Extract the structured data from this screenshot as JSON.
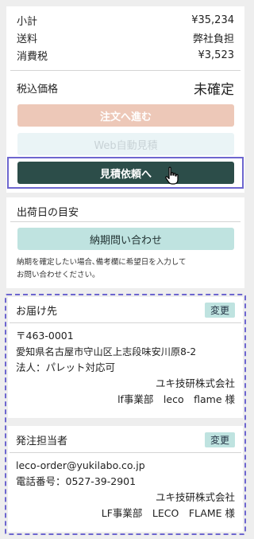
{
  "summary": {
    "subtotal_label": "小計",
    "subtotal_value": "¥35,234",
    "shipping_label": "送料",
    "shipping_value": "弊社負担",
    "tax_label": "消費税",
    "tax_value": "¥3,523",
    "total_label": "税込価格",
    "total_value": "未確定"
  },
  "actions": {
    "order_label": "注文へ進む",
    "web_quote_label": "Web自動見積",
    "quote_request_label": "見積依頼へ"
  },
  "shipping_date": {
    "title": "出荷日の目安",
    "inquiry_label": "納期問い合わせ",
    "note_line1": "納期を確定したい場合､備考欄に希望日を入力して",
    "note_line2": "お問い合わせください。"
  },
  "delivery": {
    "title": "お届け先",
    "edit_label": "変更",
    "postal": "〒463-0001",
    "address": "愛知県名古屋市守山区上志段味安川原8-2",
    "corp": "法人：パレット対応可",
    "company": "ユキ技研株式会社",
    "dept": "lf事業部　leco　flame 様"
  },
  "orderer": {
    "title": "発注担当者",
    "edit_label": "変更",
    "email": "leco-order@yukilabo.co.jp",
    "phone": "電話番号：0527-39-2901",
    "company": "ユキ技研株式会社",
    "dept": "LF事業部　LECO　FLAME 様"
  },
  "colors": {
    "order_button": "#edc8b8",
    "web_quote_button": "#eaf4f6",
    "quote_request_button": "#2c4d49",
    "inquiry_button": "#bfe3e0",
    "highlight_border": "#6d66cf"
  }
}
